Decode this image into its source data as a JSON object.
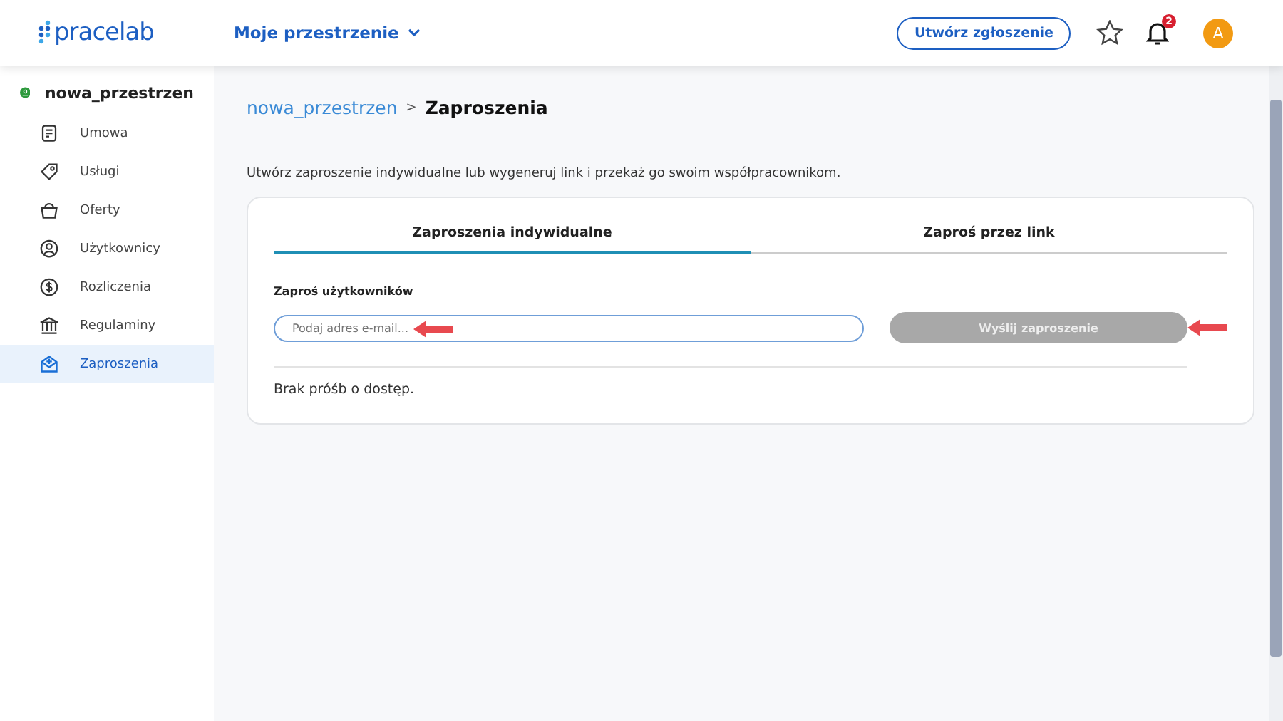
{
  "header": {
    "logo": "pracelab",
    "spaces_menu": "Moje przestrzenie",
    "create_button": "Utwórz zgłoszenie",
    "notifications_badge": "2",
    "avatar": "A"
  },
  "sidebar": {
    "workspace": "nowa_przestrzen",
    "items": [
      {
        "label": "Umowa",
        "selected": false
      },
      {
        "label": "Usługi",
        "selected": false
      },
      {
        "label": "Oferty",
        "selected": false
      },
      {
        "label": "Użytkownicy",
        "selected": false
      },
      {
        "label": "Rozliczenia",
        "selected": false
      },
      {
        "label": "Regulaminy",
        "selected": false
      },
      {
        "label": "Zaproszenia",
        "selected": true
      }
    ]
  },
  "breadcrumb": {
    "parent": "nowa_przestrzen",
    "separator": ">",
    "current": "Zaproszenia"
  },
  "intro": "Utwórz zaproszenie indywidualne lub wygeneruj link i przekaż go swoim współpracownikom.",
  "tabs": [
    {
      "label": "Zaproszenia indywidualne",
      "selected": true
    },
    {
      "label": "Zaproś przez link",
      "selected": false
    }
  ],
  "invite": {
    "label": "Zaproś użytkowników",
    "placeholder": "Podaj adres e-mail...",
    "send_button": {
      "label": "Wyślij zaproszenie",
      "disabled": true
    }
  },
  "empty_message": "Brak próśb o dostęp."
}
